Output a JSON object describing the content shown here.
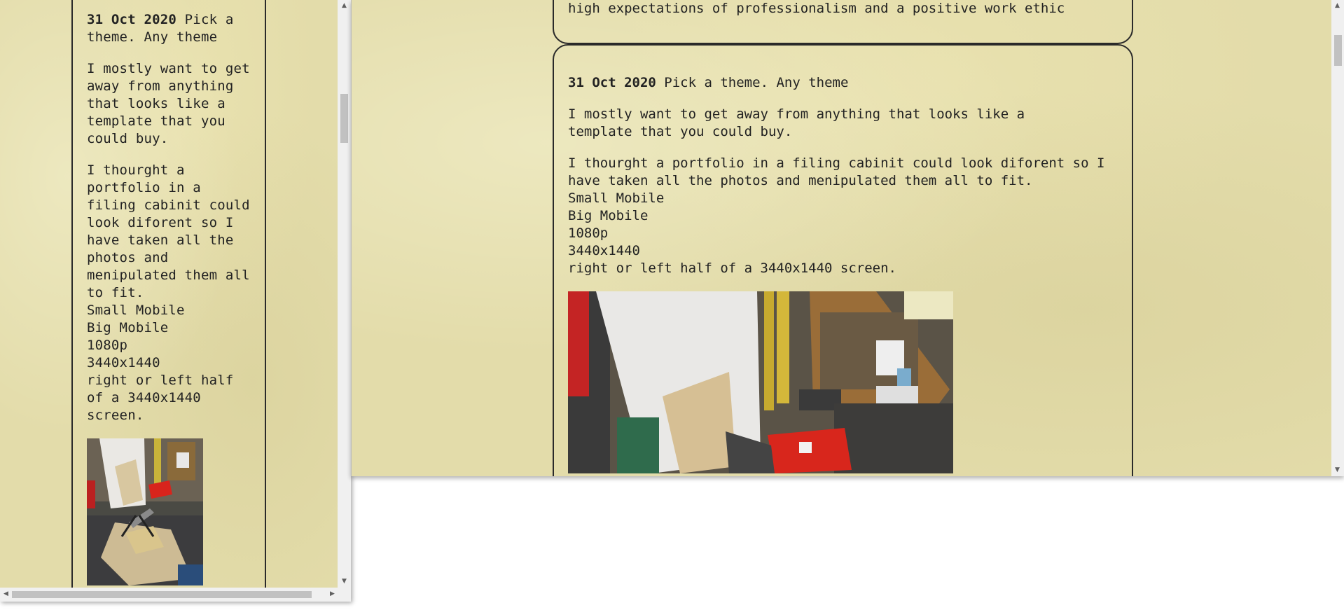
{
  "left_window": {
    "post": {
      "date": "31 Oct 2020",
      "title": "Pick a theme. Any theme",
      "paragraph1": "I mostly want to get away from anything that looks like a template that you could buy.",
      "paragraph2": "I thourght a portfolio in a filing cabinit could look diforent so I have taken all the photos and menipulated them all to fit.",
      "sizes": [
        "Small Mobile",
        "Big Mobile",
        "1080p",
        "3440x1440",
        "right or left half of a 3440x1440 screen."
      ]
    }
  },
  "right_window": {
    "previous_post_tail": "high expectations of professionalism and a positive work ethic",
    "post": {
      "date": "31 Oct 2020",
      "title": "Pick a theme. Any theme",
      "paragraph1": "I mostly want to get away from anything that looks like a template that you could buy.",
      "paragraph2": "I thourght a portfolio in a filing cabinit could look diforent so I have taken all the photos and menipulated them all to fit.",
      "sizes": [
        "Small Mobile",
        "Big Mobile",
        "1080p",
        "3440x1440",
        "right or left half of a 3440x1440 screen."
      ]
    }
  },
  "icons": {
    "scroll_up": "▲",
    "scroll_down": "▼",
    "scroll_left": "◀",
    "scroll_right": "▶"
  },
  "colors": {
    "paper": "#e3dcaa",
    "ink": "#222222",
    "border": "#2a2a2a",
    "scrollbar_track": "#f0f0f0",
    "scrollbar_thumb": "#c1c1c1"
  }
}
